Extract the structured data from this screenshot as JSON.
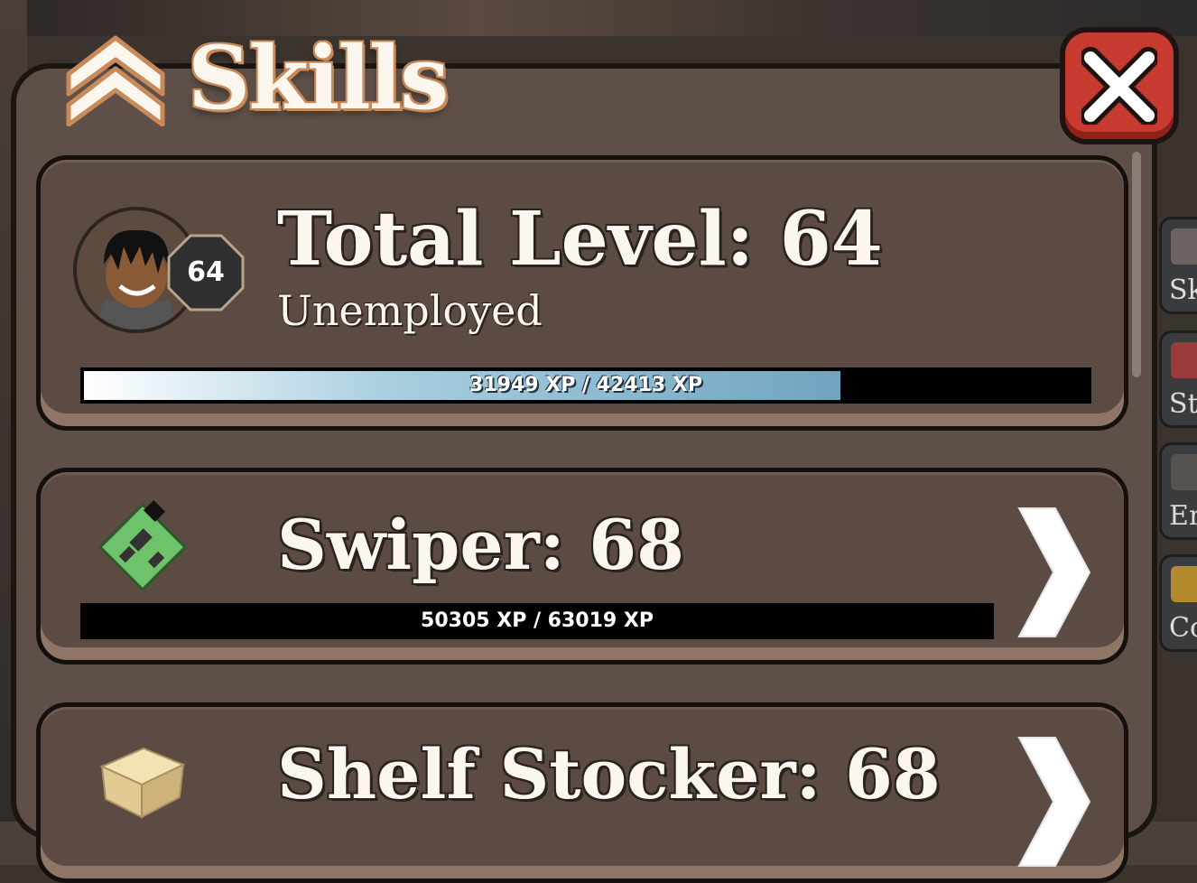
{
  "window": {
    "title": "Skills"
  },
  "close": {
    "label": "close"
  },
  "total": {
    "title": "Total Level: 64",
    "subtitle": "Unemployed",
    "level_badge": "64",
    "xp_text": "31949 XP / 42413 XP",
    "xp_current": 31949,
    "xp_max": 42413
  },
  "skills": [
    {
      "title": "Swiper: 68",
      "xp_text": "50305 XP / 63019 XP",
      "xp_current": 50305,
      "xp_max": 63019,
      "icon": "circuit-board-icon"
    },
    {
      "title": "Shelf Stocker: 68",
      "icon": "cardboard-box-icon"
    }
  ],
  "side_menu": [
    {
      "label": "Sk",
      "icon": "skills-icon"
    },
    {
      "label": "St",
      "icon": "store-icon"
    },
    {
      "label": "Em",
      "icon": "emote-icon"
    },
    {
      "label": "Co",
      "icon": "codes-icon"
    }
  ],
  "colors": {
    "panel": "#5e5048",
    "card": "#5b4b43",
    "close_button": "#c63a2f",
    "title_outline": "#c98a5a",
    "xp_fill": "#a9cfe0"
  }
}
